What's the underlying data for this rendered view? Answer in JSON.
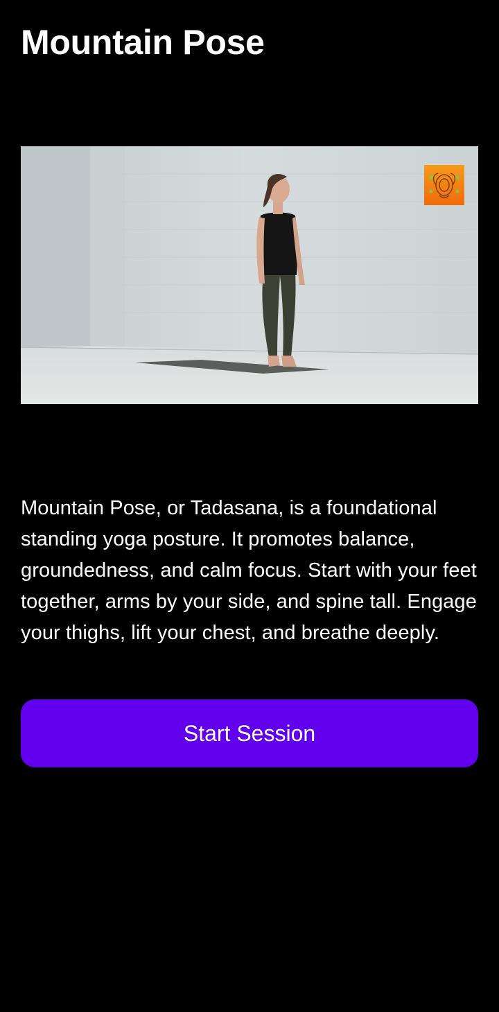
{
  "header": {
    "title": "Mountain Pose"
  },
  "media": {
    "image_alt": "Woman standing in mountain pose on a yoga mat",
    "watermark_icon": "ornament-logo-icon"
  },
  "content": {
    "description": "Mountain Pose, or Tadasana, is a foundational standing yoga posture. It promotes balance, groundedness, and calm focus. Start with your feet together, arms by your side, and spine tall. Engage your thighs, lift your chest, and breathe deeply."
  },
  "actions": {
    "start_label": "Start Session"
  },
  "colors": {
    "background": "#000000",
    "text": "#ffffff",
    "accent": "#6200ee"
  }
}
